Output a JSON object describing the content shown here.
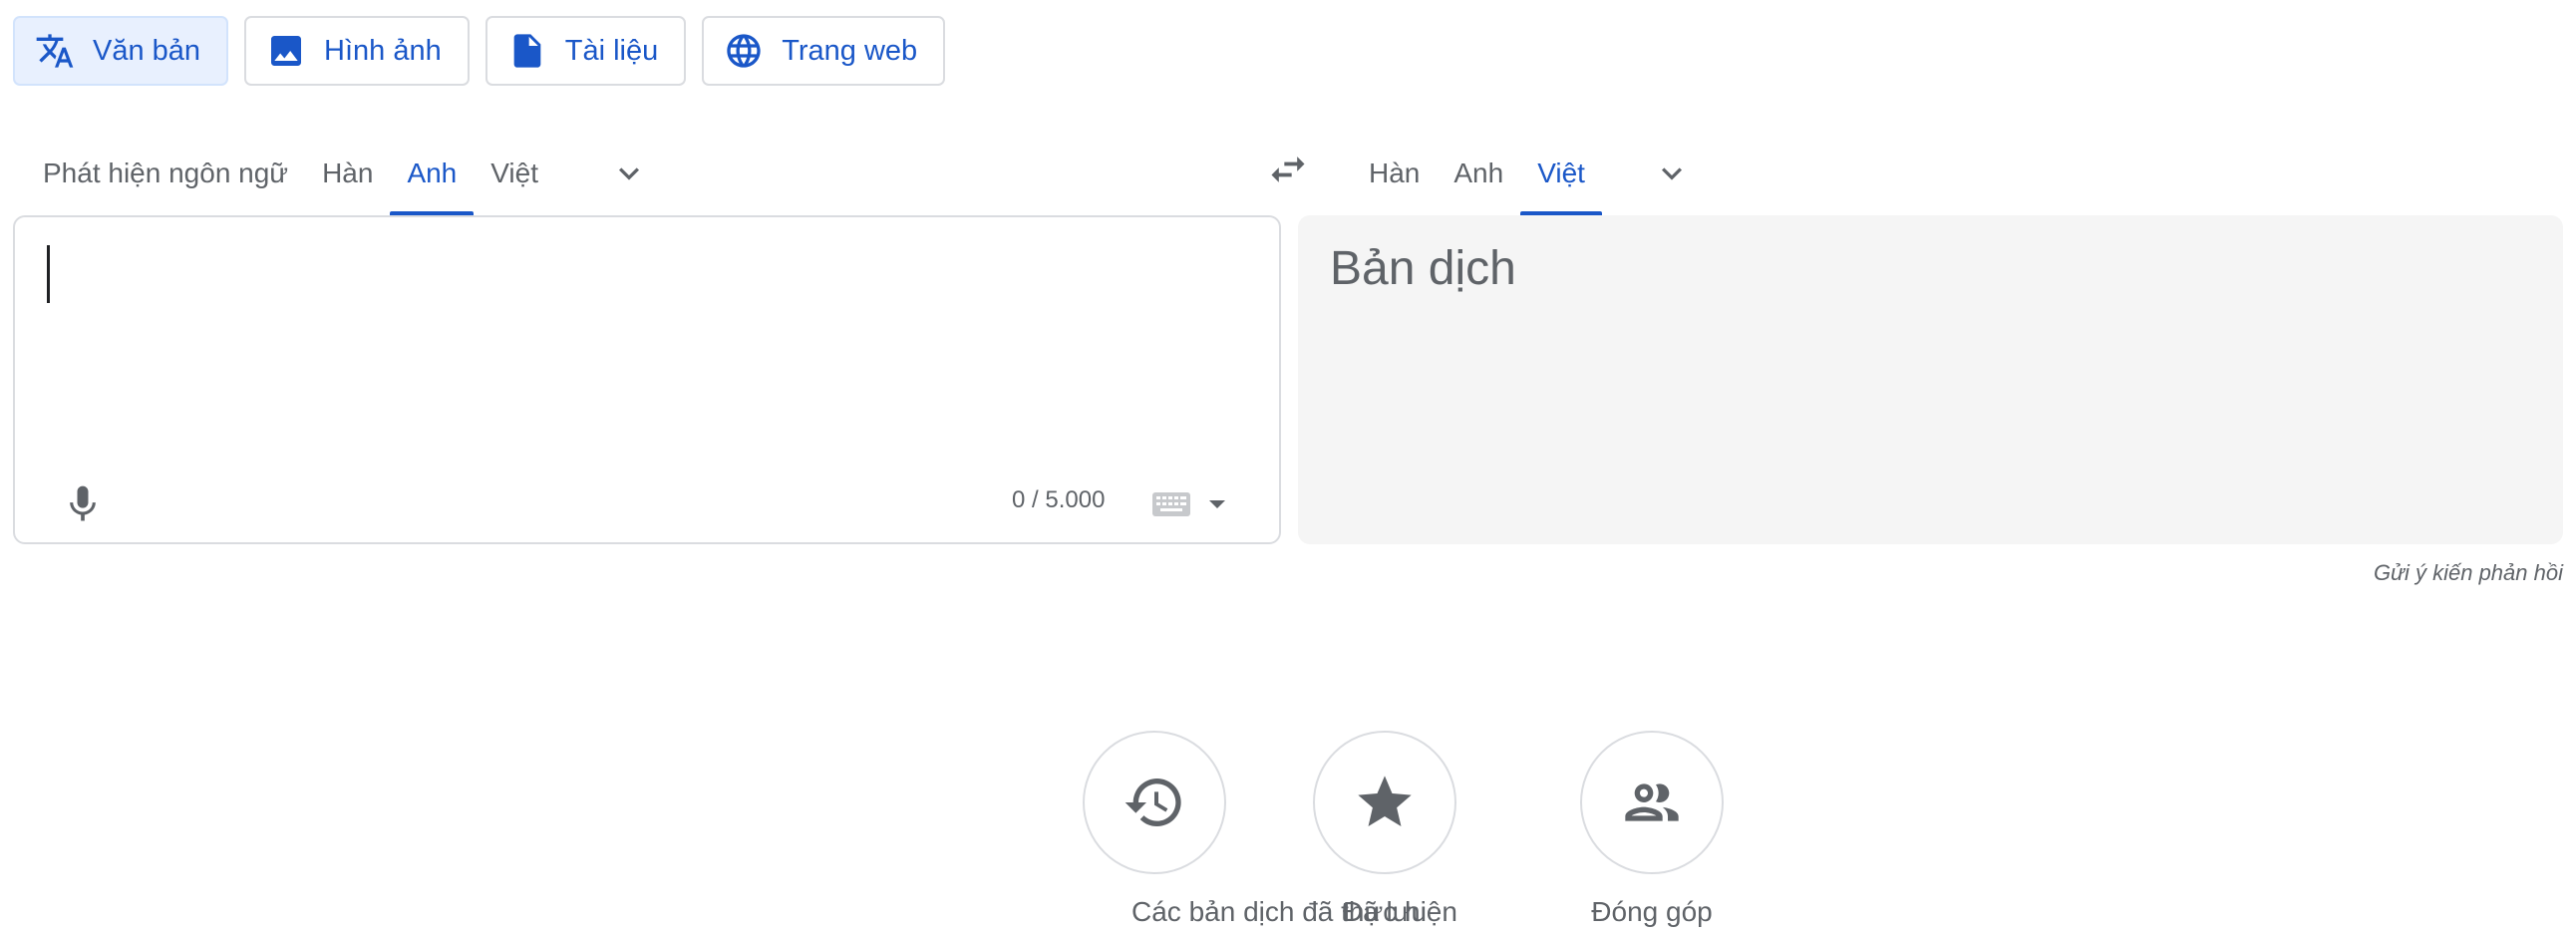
{
  "modes": [
    {
      "label": "Văn bản",
      "icon": "translate-icon",
      "active": true
    },
    {
      "label": "Hình ảnh",
      "icon": "image-icon"
    },
    {
      "label": "Tài liệu",
      "icon": "document-icon"
    },
    {
      "label": "Trang web",
      "icon": "globe-icon"
    }
  ],
  "source_langs": [
    "Phát hiện ngôn ngữ",
    "Hàn",
    "Anh",
    "Việt"
  ],
  "source_active": "Anh",
  "target_langs": [
    "Hàn",
    "Anh",
    "Việt"
  ],
  "target_active": "Việt",
  "source": {
    "value": "",
    "char_count": "0 / 5.000"
  },
  "target": {
    "placeholder": "Bản dịch"
  },
  "feedback_label": "Gửi ý kiến phản hồi",
  "actions": [
    {
      "label": "Các bản dịch đã thực hiện",
      "icon": "history-icon"
    },
    {
      "label": "Đã lưu",
      "icon": "star-icon"
    },
    {
      "label": "Đóng góp",
      "icon": "people-icon"
    }
  ],
  "colors": {
    "accent": "#1a57c8",
    "active_tab_bg": "#e8f0fe",
    "target_bg": "#f5f5f5",
    "icon_gray": "#5f6368"
  }
}
